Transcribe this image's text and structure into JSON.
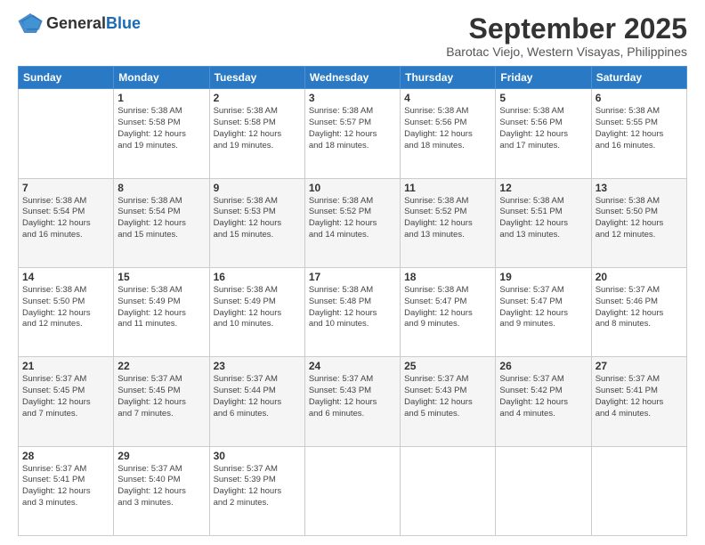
{
  "header": {
    "logo_general": "General",
    "logo_blue": "Blue",
    "month_title": "September 2025",
    "location": "Barotac Viejo, Western Visayas, Philippines"
  },
  "days_of_week": [
    "Sunday",
    "Monday",
    "Tuesday",
    "Wednesday",
    "Thursday",
    "Friday",
    "Saturday"
  ],
  "weeks": [
    [
      {
        "day": "",
        "content": ""
      },
      {
        "day": "1",
        "content": "Sunrise: 5:38 AM\nSunset: 5:58 PM\nDaylight: 12 hours\nand 19 minutes."
      },
      {
        "day": "2",
        "content": "Sunrise: 5:38 AM\nSunset: 5:58 PM\nDaylight: 12 hours\nand 19 minutes."
      },
      {
        "day": "3",
        "content": "Sunrise: 5:38 AM\nSunset: 5:57 PM\nDaylight: 12 hours\nand 18 minutes."
      },
      {
        "day": "4",
        "content": "Sunrise: 5:38 AM\nSunset: 5:56 PM\nDaylight: 12 hours\nand 18 minutes."
      },
      {
        "day": "5",
        "content": "Sunrise: 5:38 AM\nSunset: 5:56 PM\nDaylight: 12 hours\nand 17 minutes."
      },
      {
        "day": "6",
        "content": "Sunrise: 5:38 AM\nSunset: 5:55 PM\nDaylight: 12 hours\nand 16 minutes."
      }
    ],
    [
      {
        "day": "7",
        "content": "Sunrise: 5:38 AM\nSunset: 5:54 PM\nDaylight: 12 hours\nand 16 minutes."
      },
      {
        "day": "8",
        "content": "Sunrise: 5:38 AM\nSunset: 5:54 PM\nDaylight: 12 hours\nand 15 minutes."
      },
      {
        "day": "9",
        "content": "Sunrise: 5:38 AM\nSunset: 5:53 PM\nDaylight: 12 hours\nand 15 minutes."
      },
      {
        "day": "10",
        "content": "Sunrise: 5:38 AM\nSunset: 5:52 PM\nDaylight: 12 hours\nand 14 minutes."
      },
      {
        "day": "11",
        "content": "Sunrise: 5:38 AM\nSunset: 5:52 PM\nDaylight: 12 hours\nand 13 minutes."
      },
      {
        "day": "12",
        "content": "Sunrise: 5:38 AM\nSunset: 5:51 PM\nDaylight: 12 hours\nand 13 minutes."
      },
      {
        "day": "13",
        "content": "Sunrise: 5:38 AM\nSunset: 5:50 PM\nDaylight: 12 hours\nand 12 minutes."
      }
    ],
    [
      {
        "day": "14",
        "content": "Sunrise: 5:38 AM\nSunset: 5:50 PM\nDaylight: 12 hours\nand 12 minutes."
      },
      {
        "day": "15",
        "content": "Sunrise: 5:38 AM\nSunset: 5:49 PM\nDaylight: 12 hours\nand 11 minutes."
      },
      {
        "day": "16",
        "content": "Sunrise: 5:38 AM\nSunset: 5:49 PM\nDaylight: 12 hours\nand 10 minutes."
      },
      {
        "day": "17",
        "content": "Sunrise: 5:38 AM\nSunset: 5:48 PM\nDaylight: 12 hours\nand 10 minutes."
      },
      {
        "day": "18",
        "content": "Sunrise: 5:38 AM\nSunset: 5:47 PM\nDaylight: 12 hours\nand 9 minutes."
      },
      {
        "day": "19",
        "content": "Sunrise: 5:37 AM\nSunset: 5:47 PM\nDaylight: 12 hours\nand 9 minutes."
      },
      {
        "day": "20",
        "content": "Sunrise: 5:37 AM\nSunset: 5:46 PM\nDaylight: 12 hours\nand 8 minutes."
      }
    ],
    [
      {
        "day": "21",
        "content": "Sunrise: 5:37 AM\nSunset: 5:45 PM\nDaylight: 12 hours\nand 7 minutes."
      },
      {
        "day": "22",
        "content": "Sunrise: 5:37 AM\nSunset: 5:45 PM\nDaylight: 12 hours\nand 7 minutes."
      },
      {
        "day": "23",
        "content": "Sunrise: 5:37 AM\nSunset: 5:44 PM\nDaylight: 12 hours\nand 6 minutes."
      },
      {
        "day": "24",
        "content": "Sunrise: 5:37 AM\nSunset: 5:43 PM\nDaylight: 12 hours\nand 6 minutes."
      },
      {
        "day": "25",
        "content": "Sunrise: 5:37 AM\nSunset: 5:43 PM\nDaylight: 12 hours\nand 5 minutes."
      },
      {
        "day": "26",
        "content": "Sunrise: 5:37 AM\nSunset: 5:42 PM\nDaylight: 12 hours\nand 4 minutes."
      },
      {
        "day": "27",
        "content": "Sunrise: 5:37 AM\nSunset: 5:41 PM\nDaylight: 12 hours\nand 4 minutes."
      }
    ],
    [
      {
        "day": "28",
        "content": "Sunrise: 5:37 AM\nSunset: 5:41 PM\nDaylight: 12 hours\nand 3 minutes."
      },
      {
        "day": "29",
        "content": "Sunrise: 5:37 AM\nSunset: 5:40 PM\nDaylight: 12 hours\nand 3 minutes."
      },
      {
        "day": "30",
        "content": "Sunrise: 5:37 AM\nSunset: 5:39 PM\nDaylight: 12 hours\nand 2 minutes."
      },
      {
        "day": "",
        "content": ""
      },
      {
        "day": "",
        "content": ""
      },
      {
        "day": "",
        "content": ""
      },
      {
        "day": "",
        "content": ""
      }
    ]
  ]
}
